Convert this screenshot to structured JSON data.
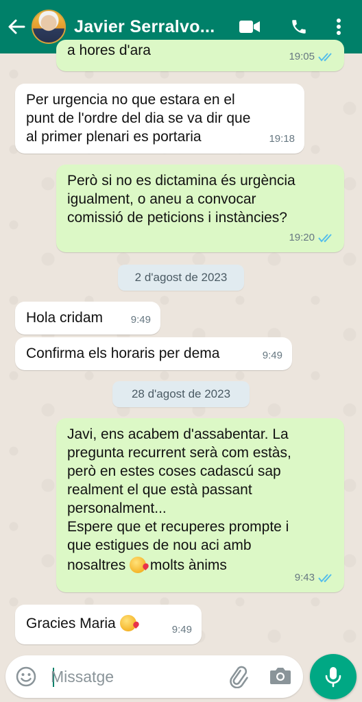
{
  "colors": {
    "header": "#008069",
    "incoming_bubble": "#ffffff",
    "outgoing_bubble": "#dcf8c6",
    "read_ticks": "#53bdeb",
    "mic_button": "#00a884"
  },
  "header": {
    "contact_name": "Javier Serralvo...",
    "icons": [
      "back-arrow-icon",
      "video-call-icon",
      "voice-call-icon",
      "more-options-icon"
    ]
  },
  "messages": [
    {
      "direction": "out",
      "text": "a hores d'ara",
      "time": "19:05",
      "read": true
    },
    {
      "direction": "in",
      "text": "Per urgencia no que estara en el\npunt de l'ordre del dia se va dir que\nal primer plenari es portaria",
      "time": "19:18"
    },
    {
      "direction": "out",
      "text": "Però si no es dictamina és urgència\nigualment, o aneu a convocar\ncomissió de peticions i instàncies?",
      "time": "19:20",
      "read": true
    },
    {
      "direction": "in",
      "text": "Hola cridam",
      "time": "9:49"
    },
    {
      "direction": "in",
      "text": "Confirma els horaris per dema",
      "time": "9:49"
    },
    {
      "direction": "out",
      "text": "Javi, ens acabem d'assabentar. La\npregunta recurrent serà com estàs,\nperò en estes coses cadascú sap\nrealment el que està passant\npersonalment...\nEspere que et recuperes prompte i\nque estigues de nou aci amb",
      "last_line_before": "nosaltres",
      "last_line_after": "molts ànims",
      "time": "9:43",
      "read": true
    },
    {
      "direction": "in",
      "text": "Gracies Maria",
      "time": "9:49"
    }
  ],
  "dates": [
    "2 d'agost de 2023",
    "28 d'agost de 2023"
  ],
  "composer": {
    "placeholder": "Missatge",
    "icons": [
      "emoji-icon",
      "attach-icon",
      "camera-icon",
      "microphone-icon"
    ]
  }
}
